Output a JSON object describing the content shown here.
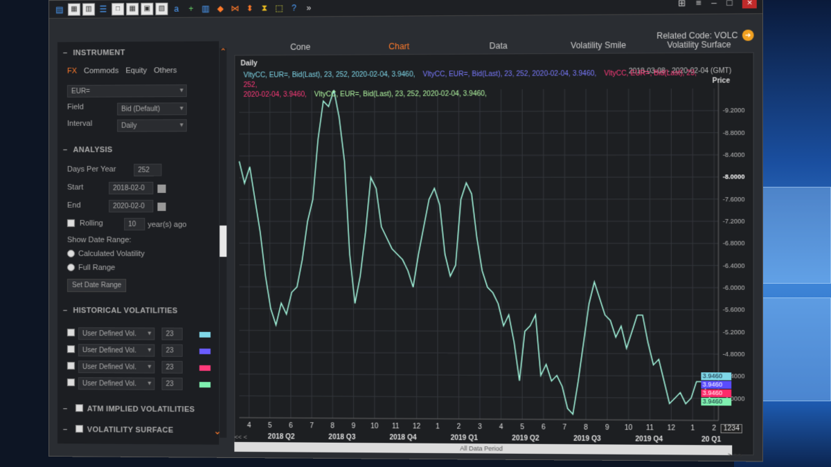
{
  "header": {
    "related_label": "Related Code: VOLC"
  },
  "left": {
    "instrument_title": "INSTRUMENT",
    "asset_tabs": [
      "FX",
      "Commods",
      "Equity",
      "Others"
    ],
    "instrument_value": "EUR=",
    "field_label": "Field",
    "field_value": "Bid (Default)",
    "interval_label": "Interval",
    "interval_value": "Daily",
    "analysis_title": "ANALYSIS",
    "days_label": "Days Per Year",
    "days_value": "252",
    "start_label": "Start",
    "start_value": "2018-02-0",
    "end_label": "End",
    "end_value": "2020-02-0",
    "rolling_label": "Rolling",
    "rolling_value": "10",
    "rolling_suffix": "year(s) ago",
    "show_range_label": "Show Date Range:",
    "radio_calc": "Calculated Volatility",
    "radio_full": "Full Range",
    "set_range_button": "Set Date Range",
    "hist_title": "HISTORICAL VOLATILITIES",
    "hist_rows": [
      {
        "label": "User Defined Vol.",
        "value": "23",
        "color": "#7fd7e8"
      },
      {
        "label": "User Defined Vol.",
        "value": "23",
        "color": "#6a5cff"
      },
      {
        "label": "User Defined Vol.",
        "value": "23",
        "color": "#ff3a7a"
      },
      {
        "label": "User Defined Vol.",
        "value": "23",
        "color": "#7ff0b0"
      }
    ],
    "atm_title": "ATM IMPLIED VOLATILITIES",
    "surface_title": "VOLATILITY SURFACE"
  },
  "tabs": [
    "Cone",
    "Chart",
    "Data",
    "Volatility Smile",
    "Volatility Surface"
  ],
  "chart_data": {
    "type": "line",
    "frame_label": "Daily",
    "date_range": "2018-03-08 - 2020-02-04 (GMT)",
    "ylabel": "Price",
    "yticks": [
      "9.2000",
      "8.8000",
      "8.4000",
      "8.0000",
      "7.6000",
      "7.2000",
      "6.8000",
      "6.4000",
      "6.0000",
      "5.6000",
      "5.2000",
      "4.8000",
      "4.4000",
      "4.0000"
    ],
    "ylim": [
      3.6,
      9.6
    ],
    "xticks": [
      "4",
      "5",
      "6",
      "7",
      "8",
      "9",
      "10",
      "11",
      "12",
      "1",
      "2",
      "3",
      "4",
      "5",
      "6",
      "7",
      "8",
      "9",
      "10",
      "11",
      "12",
      "1",
      "2"
    ],
    "quarters": [
      "2018 Q2",
      "2018 Q3",
      "2018 Q4",
      "2019 Q1",
      "2019 Q2",
      "2019 Q3",
      "2019 Q4",
      "20 Q1"
    ],
    "legend": [
      {
        "text": "VltyCC, EUR=, Bid(Last), 23, 252, 2020-02-04, 3.9460,",
        "color": "#7fd7e8"
      },
      {
        "text": "VltyCC, EUR=, Bid(Last), 23, 252, 2020-02-04, 3.9460,",
        "color": "#7a7aff"
      },
      {
        "text": "VltyCC, EUR=, Bid(Last), 23, 252,",
        "color": "#ff3a7a"
      },
      {
        "text": "2020-02-04, 3.9460,",
        "color": "#ff3a7a"
      },
      {
        "text": "VltyCC, EUR=, Bid(Last), 23, 252, 2020-02-04, 3.9460,",
        "color": "#b0f5a0"
      }
    ],
    "last_tags": [
      {
        "text": "3.9460",
        "color": "#7fd7e8"
      },
      {
        "text": "3.9460",
        "color": "#5a4cff"
      },
      {
        "text": "3.9460",
        "color": "#ff2a6a"
      },
      {
        "text": "3.9460",
        "color": "#7ff0b0"
      }
    ],
    "zoom": "1234",
    "series": [
      {
        "values": [
          8.3,
          7.9,
          8.2,
          7.6,
          7.0,
          6.2,
          5.6,
          5.3,
          5.7,
          5.5,
          5.9,
          6.0,
          6.5,
          7.2,
          7.6,
          8.7,
          9.4,
          9.3,
          9.6,
          9.1,
          8.3,
          6.6,
          5.7,
          6.2,
          7.0,
          8.0,
          7.8,
          7.1,
          6.9,
          6.7,
          6.6,
          6.5,
          6.3,
          6.0,
          6.6,
          7.1,
          7.6,
          7.8,
          7.5,
          6.6,
          6.2,
          6.4,
          7.6,
          7.9,
          7.7,
          6.9,
          6.3,
          6.0,
          5.9,
          5.7,
          5.3,
          5.5,
          5.0,
          4.3,
          5.2,
          5.3,
          5.5,
          4.4,
          4.6,
          4.3,
          4.4,
          4.2,
          3.8,
          3.7,
          4.3,
          5.0,
          5.7,
          6.1,
          5.8,
          5.5,
          5.4,
          5.1,
          5.3,
          4.9,
          5.2,
          5.5,
          5.5,
          5.0,
          4.6,
          4.7,
          4.3,
          3.9,
          4.0,
          4.1,
          3.9,
          4.0,
          4.3,
          4.3,
          4.1,
          3.9
        ]
      }
    ]
  },
  "status": {
    "center": "All Data Period",
    "left": "<<  <",
    "pager": ">  >>"
  }
}
